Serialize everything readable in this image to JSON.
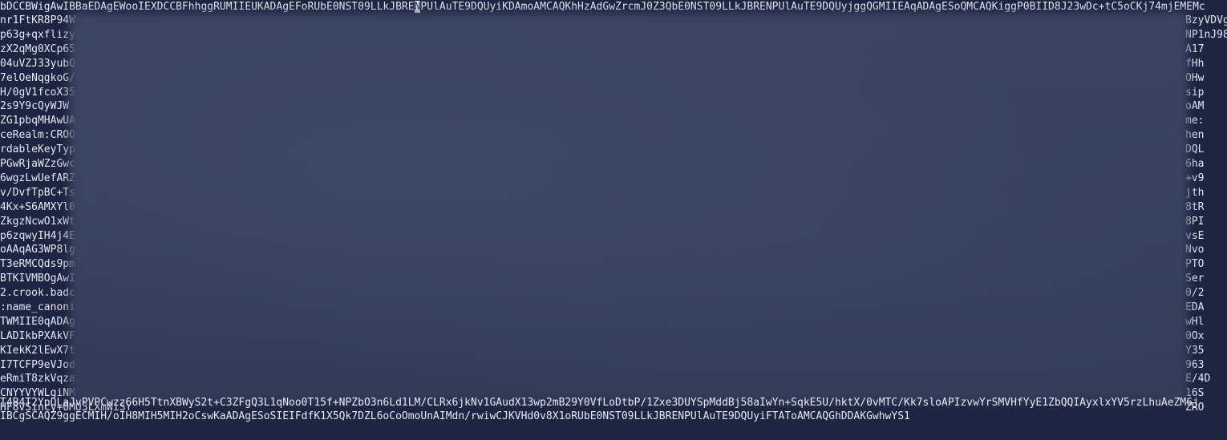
{
  "terminal": {
    "colors": {
      "background": "#1c2541",
      "foreground": "#e6e9f2",
      "blur": "#3a4462"
    },
    "first_line": {
      "before_cursor": "bDCCBWigAwIBBaEDAgEWooIEXDCCBFhhggRUMIIEUKADAgEFoRUbE0NST09LLkJBRE",
      "cursor_char": "N",
      "after_cursor": "PUlAuTE9DQUyiKDAmoAMCAQKhHzAdGwZrcmJ0Z3QbE0NST09LLkJBRENPUlAuTE9DQUyjggQGMIIEAqADAgESoQMCAQKiggP0BIID8J23wDc+tC5oCKj74mjEMEMc"
    },
    "left_fragments": [
      "nr1FtKR8P94W",
      "p63g+qxflizy",
      "zX2qMg0XCp65",
      "04uVZJ33yubQ",
      "7elOeNqgkoG/",
      "H/0gV1fcoX35",
      "2s9Y9cQyWJW",
      "ZG1pbqMHAwUA",
      "ceRealm:CROO",
      "rdableKeyTyp",
      "PGwRjaWZzGwc",
      "6wgzLwUefARZ",
      "v/DvfTpBC+Ts",
      "4Kx+S6AMXYl0",
      "ZkgzNcwO1xWt",
      "p6zqwyIH4j4E",
      "oAAqAG3WP8lg",
      "T3eRMCQds9pm",
      "BTKIVMBOgAwI",
      "2.crook.badc",
      ":name_canoni",
      "TWMIIE0qADAg",
      "LADIkbPXAkVF",
      "KIekK2lEwX7t",
      "I7TCFP9eVJod",
      "eRmiT8zkVqza",
      "CNYYVYWLgiNM",
      "HF8vSincy+0MU3LXmWiSY"
    ],
    "right_fragments": [
      "BzyVDVg",
      "NP1nJ98",
      "A17",
      "fHh",
      "OHw",
      "sip",
      "oAM",
      "me:",
      "hen",
      "DQL",
      "6ha",
      "+v9",
      "jth",
      "8tR",
      "8PI",
      "vsE",
      "Nvo",
      "PTO",
      "Ser",
      "0/2",
      "EDA",
      "wHl",
      "0Ox",
      "Y35",
      "963",
      "E/4D",
      "16S",
      "ZRO"
    ],
    "bottom_lines": [
      "T4B4T2YpOLaJvPVPCwzz66H5TtnXBWyS2t+C3ZFgQ3L1qNoo0T15f+NPZbO3n6Ld1LM/CLRx6jkNv1GAudX13wp2mB29Y0VfLoDtbP/1Zxe3DUYSpMddBj58aIwYn+SqkE5U/hktX/0vMTC/Kk7sloAPIzvwYrSMVHfYyE1ZbQQIAyxlxYV5rzLhuAeZM6j",
      "IBCgSCAQZ9ggECMIH/oIH8MIH5MIH2oCswKaADAgESoSIEIFdfK1X5Qk7DZL6oCoOmoUnAIMdn/rwiwCJKVHd0v8X1oRUbE0NST09LLkJBRENPUlAuTE9DQUyiFTAToAMCAQGhDDAKGwhwYS1"
    ]
  }
}
